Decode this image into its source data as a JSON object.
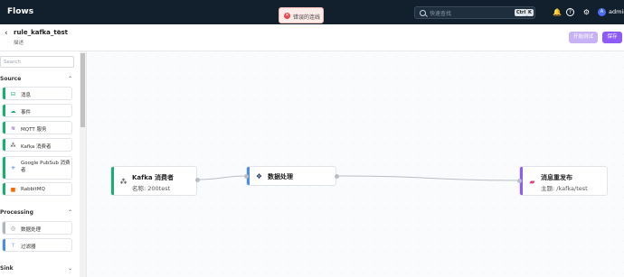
{
  "app": {
    "title": "Flows"
  },
  "search": {
    "placeholder": "快速查找",
    "shortcut_ctrl": "Ctrl",
    "shortcut_key": "K"
  },
  "topbar": {
    "user": "admin",
    "avatar_letter": "A"
  },
  "toast": {
    "message": "错误的连线",
    "type": "error"
  },
  "header": {
    "rule_name": "rule_kafka_test",
    "description": "描述",
    "test_button": "开始测试",
    "save_button": "保存"
  },
  "sidebar": {
    "search_placeholder": "Search",
    "sections": [
      {
        "title": "Source",
        "items": [
          {
            "label": "消息",
            "icon": "message-icon",
            "color": "#1aae6f"
          },
          {
            "label": "事件",
            "icon": "event-icon",
            "color": "#1aae6f"
          },
          {
            "label": "MQTT 服务",
            "icon": "mqtt-icon",
            "color": "#1aae6f"
          },
          {
            "label": "Kafka 消费者",
            "icon": "kafka-icon",
            "color": "#1aae6f"
          },
          {
            "label": "Google PubSub 消费者",
            "icon": "pubsub-icon",
            "color": "#1aae6f"
          },
          {
            "label": "RabbitMQ",
            "icon": "rabbitmq-icon",
            "color": "#1aae6f"
          }
        ]
      },
      {
        "title": "Processing",
        "items": [
          {
            "label": "数据处理",
            "icon": "data-processing-icon",
            "color": "#b0b5bc"
          },
          {
            "label": "过滤器",
            "icon": "filter-icon",
            "color": "#4a90e2"
          }
        ]
      },
      {
        "title": "Sink",
        "items": []
      }
    ]
  },
  "canvas": {
    "nodes": [
      {
        "title": "Kafka 消费者",
        "subtitle": "名称: 200test",
        "icon": "kafka-icon",
        "color": "#1aae6f"
      },
      {
        "title": "数据处理",
        "subtitle": "",
        "icon": "data-processing-icon",
        "color": "#4a90e2"
      },
      {
        "title": "消息重发布",
        "subtitle": "主题: /kafka/test",
        "icon": "republish-icon",
        "color": "#8d5cf6"
      }
    ]
  }
}
